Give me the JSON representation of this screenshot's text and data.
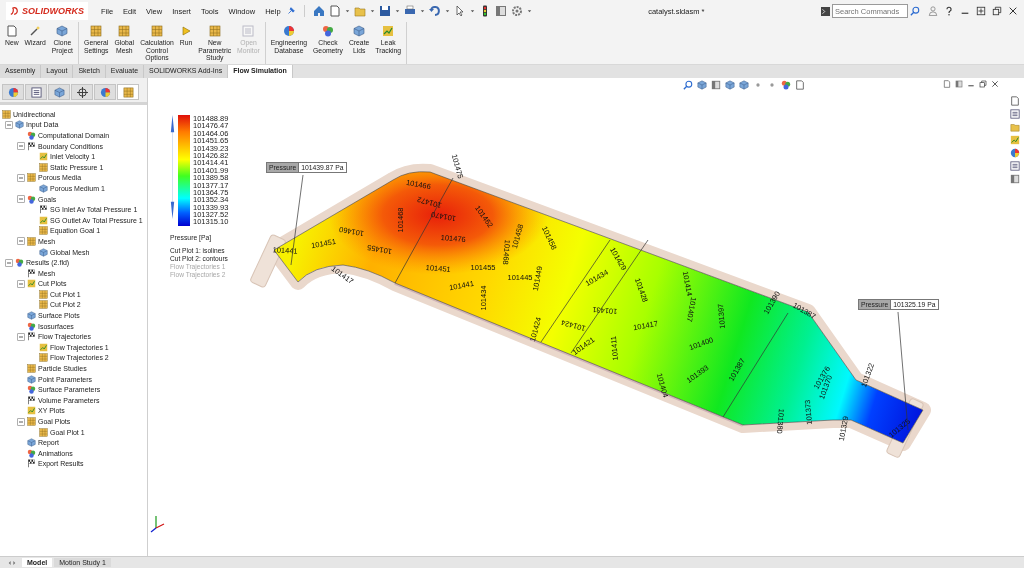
{
  "app": {
    "logo": "SOLIDWORKS"
  },
  "menu": [
    {
      "label": "File"
    },
    {
      "label": "Edit"
    },
    {
      "label": "View"
    },
    {
      "label": "Insert"
    },
    {
      "label": "Tools"
    },
    {
      "label": "Window"
    },
    {
      "label": "Help"
    }
  ],
  "document_title": "catalyst.sldasm *",
  "search": {
    "placeholder": "Search Commands"
  },
  "command_groups": [
    [
      {
        "label": "New",
        "disabled": false
      },
      {
        "label": "Wizard",
        "disabled": false
      },
      {
        "label": "Clone\nProject",
        "disabled": false
      }
    ],
    [
      {
        "label": "General\nSettings",
        "disabled": false
      },
      {
        "label": "Global\nMesh",
        "disabled": false
      },
      {
        "label": "Calculation\nControl\nOptions",
        "disabled": false
      },
      {
        "label": "Run",
        "disabled": false
      },
      {
        "label": "New\nParametric\nStudy",
        "disabled": false
      },
      {
        "label": "Open\nMonitor",
        "disabled": true
      }
    ],
    [
      {
        "label": "Engineering\nDatabase",
        "disabled": false
      },
      {
        "label": "Check\nGeometry",
        "disabled": false
      },
      {
        "label": "Create\nLids",
        "disabled": false
      },
      {
        "label": "Leak\nTracking",
        "disabled": false
      }
    ]
  ],
  "tabs": [
    {
      "label": "Assembly",
      "selected": false
    },
    {
      "label": "Layout",
      "selected": false
    },
    {
      "label": "Sketch",
      "selected": false
    },
    {
      "label": "Evaluate",
      "selected": false
    },
    {
      "label": "SOLIDWORKS Add-Ins",
      "selected": false
    },
    {
      "label": "Flow Simulation",
      "selected": true
    }
  ],
  "panel_tabs": [
    {
      "selected": false
    },
    {
      "selected": false
    },
    {
      "selected": false
    },
    {
      "selected": false
    },
    {
      "selected": false
    },
    {
      "selected": true
    }
  ],
  "tree": {
    "label": "Unidirectional",
    "children": [
      {
        "label": "Input Data",
        "expanded": true,
        "children": [
          {
            "label": "Computational Domain"
          },
          {
            "label": "Boundary Conditions",
            "expanded": true,
            "children": [
              {
                "label": "Inlet Velocity 1"
              },
              {
                "label": "Static Pressure 1"
              }
            ]
          },
          {
            "label": "Porous Media",
            "expanded": true,
            "children": [
              {
                "label": "Porous Medium 1"
              }
            ]
          },
          {
            "label": "Goals",
            "expanded": true,
            "children": [
              {
                "label": "SG Inlet Av Total Pressure 1"
              },
              {
                "label": "SG Outlet Av Total Pressure 1"
              },
              {
                "label": "Equation Goal 1"
              }
            ]
          },
          {
            "label": "Mesh",
            "expanded": true,
            "children": [
              {
                "label": "Global Mesh"
              }
            ]
          }
        ]
      },
      {
        "label": "Results (2.fld)",
        "expanded": true,
        "children": [
          {
            "label": "Mesh"
          },
          {
            "label": "Cut Plots",
            "expanded": true,
            "children": [
              {
                "label": "Cut Plot 1"
              },
              {
                "label": "Cut Plot 2"
              }
            ]
          },
          {
            "label": "Surface Plots"
          },
          {
            "label": "Isosurfaces"
          },
          {
            "label": "Flow Trajectories",
            "expanded": true,
            "children": [
              {
                "label": "Flow Trajectories 1"
              },
              {
                "label": "Flow Trajectories 2"
              }
            ]
          },
          {
            "label": "Particle Studies"
          },
          {
            "label": "Point Parameters"
          },
          {
            "label": "Surface Parameters"
          },
          {
            "label": "Volume Parameters"
          },
          {
            "label": "XY Plots"
          },
          {
            "label": "Goal Plots",
            "expanded": true,
            "children": [
              {
                "label": "Goal Plot 1"
              }
            ]
          },
          {
            "label": "Report"
          },
          {
            "label": "Animations"
          },
          {
            "label": "Export Results"
          }
        ]
      }
    ]
  },
  "legend": {
    "values": [
      "101488.89",
      "101476.47",
      "101464.06",
      "101451.65",
      "101439.23",
      "101426.82",
      "101414.41",
      "101401.99",
      "101389.58",
      "101377.17",
      "101364.75",
      "101352.34",
      "101339.93",
      "101327.52",
      "101315.10"
    ],
    "title": "Pressure [Pa]",
    "notes": [
      {
        "text": "Cut Plot 1: isolines",
        "disabled": false
      },
      {
        "text": "Cut Plot 2: contours",
        "disabled": false
      },
      {
        "text": "Flow Trajectories 1",
        "disabled": true
      },
      {
        "text": "Flow Trajectories 2",
        "disabled": true
      }
    ]
  },
  "probes": [
    {
      "label": "Pressure",
      "value": "101439.87 Pa"
    },
    {
      "label": "Pressure",
      "value": "101325.19 Pa"
    }
  ],
  "isoline_labels": [
    "101466",
    "101475",
    "101472",
    "101470",
    "101468",
    "101462",
    "101458",
    "101458",
    "101476",
    "101468",
    "101451",
    "101455",
    "101441",
    "101451",
    "101460",
    "101455",
    "101417",
    "101441",
    "101434",
    "101445",
    "101449",
    "101424",
    "101424",
    "101421",
    "101434",
    "101431",
    "101429",
    "101428",
    "101417",
    "101411",
    "101414",
    "101407",
    "101397",
    "101400",
    "101393",
    "101387",
    "101404",
    "101390",
    "101387",
    "101376",
    "101370",
    "101373",
    "101380",
    "101322",
    "101329",
    "101325"
  ],
  "bottom_tabs": [
    {
      "label": "Model",
      "selected": true
    },
    {
      "label": "Motion Study 1",
      "selected": false
    }
  ]
}
